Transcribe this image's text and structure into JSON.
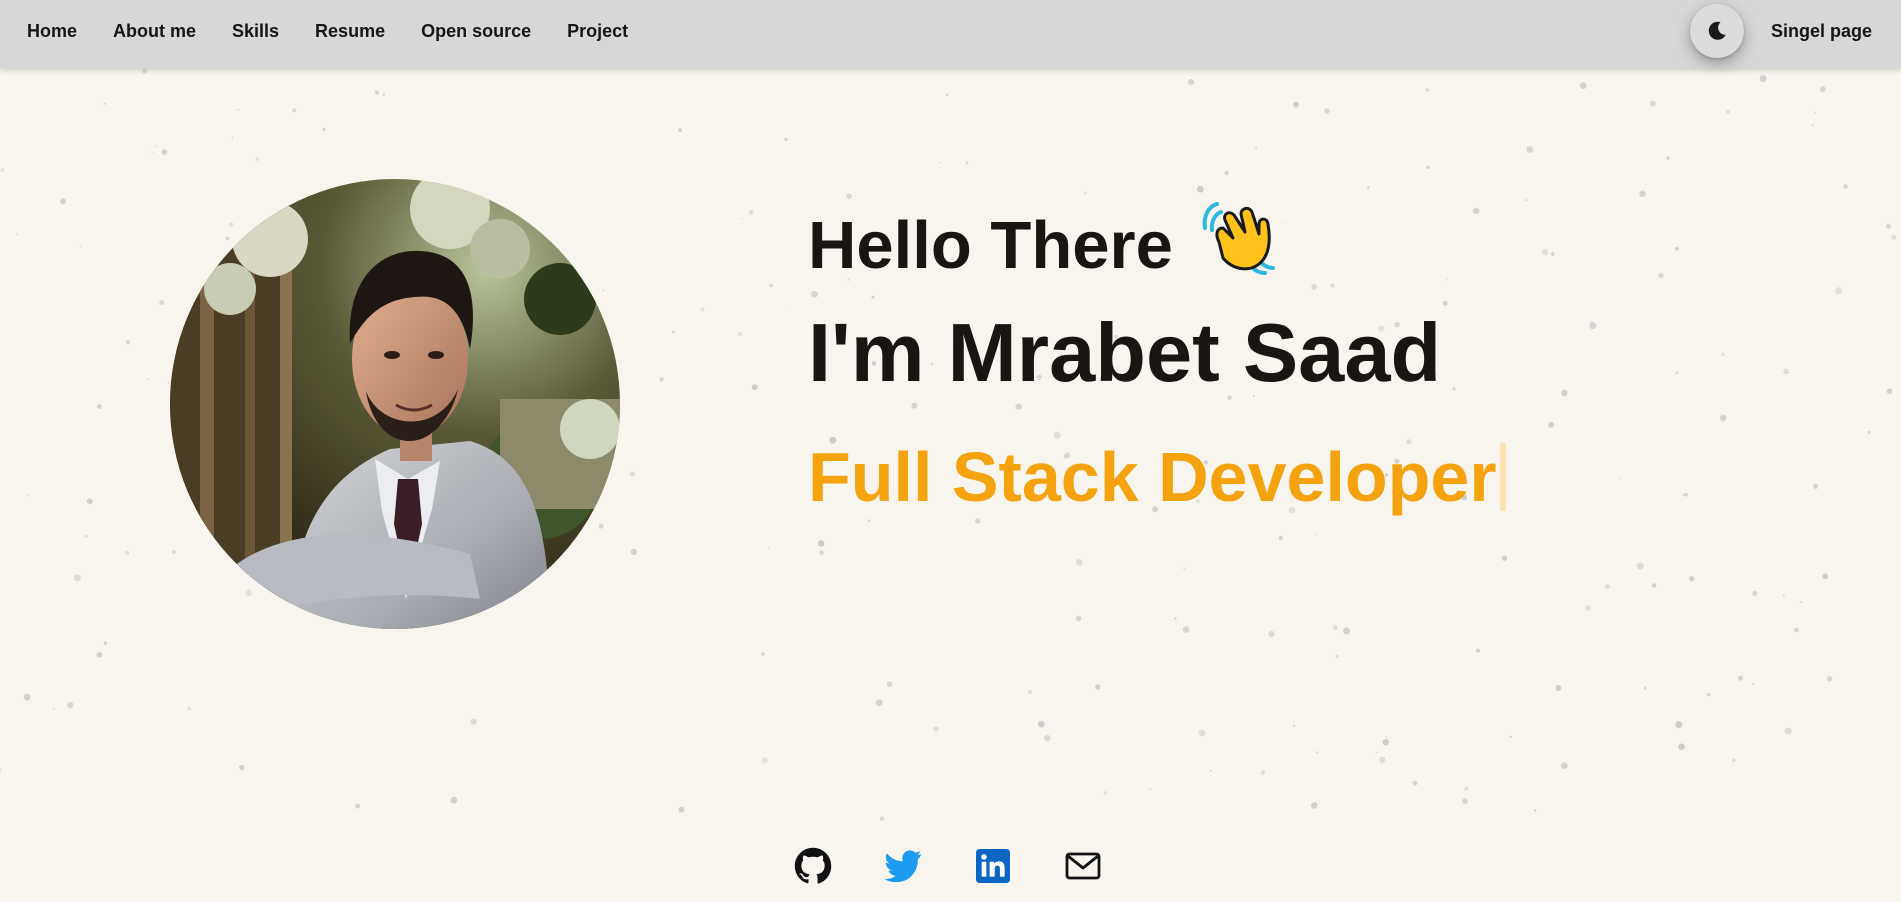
{
  "nav": {
    "links": [
      "Home",
      "About me",
      "Skills",
      "Resume",
      "Open source",
      "Project"
    ],
    "single_page": "Singel page",
    "theme_toggle_icon": "moon-icon"
  },
  "hero": {
    "greeting": "Hello There",
    "greeting_icon": "waving-hand-icon",
    "name": "I'm Mrabet Saad",
    "role": "Full Stack Developer",
    "avatar_icon": "profile-photo"
  },
  "social": {
    "icons": [
      "github-icon",
      "twitter-icon",
      "linkedin-icon",
      "mail-icon"
    ]
  },
  "colors": {
    "background": "#f8f5ef",
    "navbar": "#d7d7d7",
    "text": "#181512",
    "accent": "#f5a20f",
    "twitter": "#1d9bf0",
    "linkedin": "#0a66c2"
  }
}
